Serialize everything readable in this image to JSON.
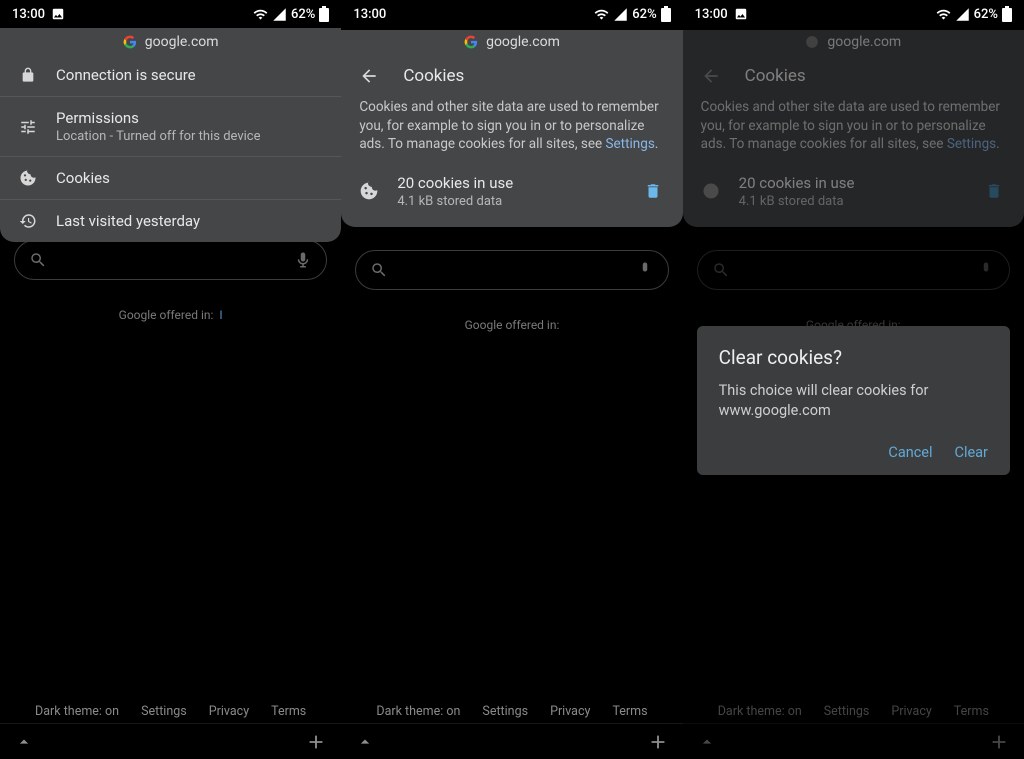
{
  "status": {
    "time": "13:00",
    "battery": "62%"
  },
  "site": "google.com",
  "panel1": {
    "secure": "Connection is secure",
    "perm_title": "Permissions",
    "perm_sub": "Location - Turned off for this device",
    "cookies": "Cookies",
    "visited": "Last visited yesterday"
  },
  "panel2": {
    "title": "Cookies",
    "desc_a": "Cookies and other site data are used to remember you, for example to sign you in or to personalize ads. To manage cookies for all sites, see ",
    "desc_link": "Settings",
    "desc_b": ".",
    "row_t1": "20 cookies in use",
    "row_t2": "4.1 kB stored data"
  },
  "dialog": {
    "title": "Clear cookies?",
    "body": "This choice will clear cookies for www.google.com",
    "cancel": "Cancel",
    "clear": "Clear"
  },
  "bg": {
    "offered": "Google offered in:",
    "dark": "Dark theme: on",
    "settings": "Settings",
    "privacy": "Privacy",
    "terms": "Terms"
  }
}
